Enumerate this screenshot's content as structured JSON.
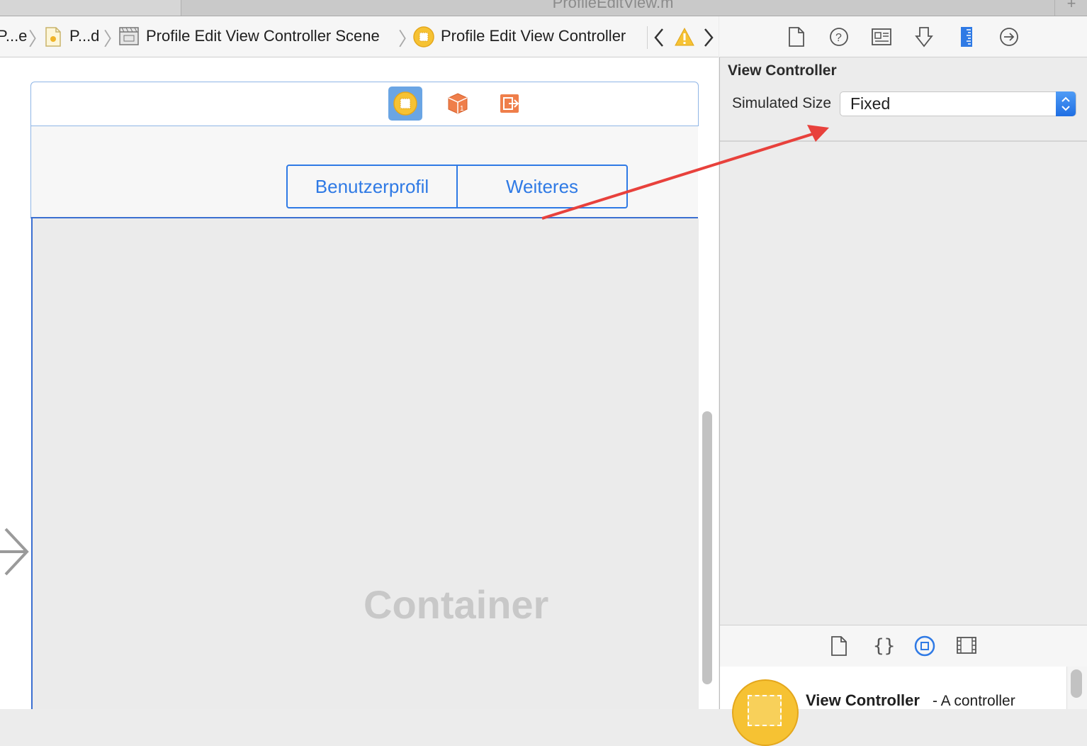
{
  "window": {
    "tab_title": "ProfileEditView.m",
    "tab_plus": "+"
  },
  "jumpbar": {
    "crumbs": [
      {
        "label": "P...e",
        "icon": "group-icon"
      },
      {
        "label": "P...d",
        "icon": "storyboard-file-icon"
      },
      {
        "label": "Profile Edit View Controller Scene",
        "icon": "scene-icon"
      },
      {
        "label": "Profile Edit View Controller",
        "icon": "view-controller-icon"
      }
    ],
    "nav_back": "back-arrow-icon",
    "nav_warning": "warning-icon",
    "nav_forward": "forward-arrow-icon"
  },
  "canvas": {
    "segmented_control": [
      "Benutzerprofil",
      "Weiteres"
    ],
    "container_label": "Container",
    "dock_icons": [
      "view-controller-icon",
      "first-responder-icon",
      "exit-icon"
    ]
  },
  "inspector": {
    "tabs": [
      "file-inspector-icon",
      "quick-help-icon",
      "identity-inspector-icon",
      "attributes-inspector-icon",
      "size-inspector-icon",
      "connections-inspector-icon"
    ],
    "active_tab": "size-inspector-icon",
    "section_title": "View Controller",
    "simulated_size_label": "Simulated Size",
    "simulated_size_value": "Fixed"
  },
  "library": {
    "tabs": [
      "file-template-icon",
      "code-snippet-icon",
      "object-library-icon",
      "media-library-icon"
    ],
    "active_tab": "object-library-icon",
    "item_name": "View Controller",
    "item_desc": "- A controller"
  },
  "colors": {
    "accent": "#2f7ae5",
    "annotation": "#e8413c",
    "selection": "#3b6fd1"
  }
}
